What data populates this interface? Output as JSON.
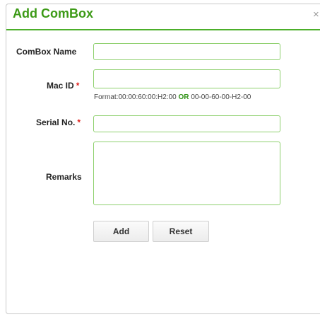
{
  "dialog": {
    "title": "Add ComBox",
    "close_glyph": "×"
  },
  "form": {
    "combox_name": {
      "label": "ComBox Name",
      "value": ""
    },
    "mac_id": {
      "label": "Mac ID",
      "required_mark": "*",
      "value": "",
      "hint_prefix": "Format:00:00:60:00:H2:00",
      "hint_or": "OR",
      "hint_suffix": "00-00-60-00-H2-00"
    },
    "serial_no": {
      "label": "Serial No.",
      "required_mark": "*",
      "value": ""
    },
    "remarks": {
      "label": "Remarks",
      "value": ""
    }
  },
  "buttons": {
    "add_label": "Add",
    "reset_label": "Reset"
  },
  "colors": {
    "accent_green": "#3c9a16",
    "field_border": "#8fd06f",
    "required_red": "#e0201b"
  }
}
